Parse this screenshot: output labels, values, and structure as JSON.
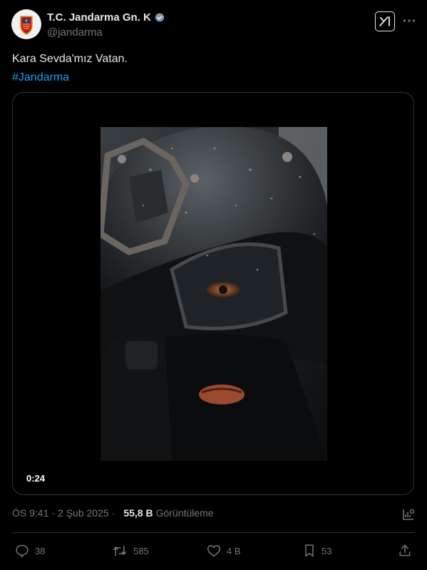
{
  "author": {
    "display_name": "T.C. Jandarma Gn. K",
    "handle": "@jandarma",
    "verified": true,
    "avatar_icon": "jandarma-emblem-icon"
  },
  "tweet": {
    "text": "Kara Sevda'mız Vatan.",
    "hashtag": "#Jandarma"
  },
  "media": {
    "type": "video",
    "duration": "0:24"
  },
  "meta": {
    "time": "ÖS 9:41",
    "separator": "·",
    "date": "2 Şub 2025",
    "views_count": "55,8 B",
    "views_label": "Görüntüleme"
  },
  "actions": {
    "replies": "38",
    "reposts": "585",
    "likes": "4 B",
    "bookmarks": "53"
  },
  "colors": {
    "background": "#000000",
    "text": "#e7e9ea",
    "muted": "#71767b",
    "accent": "#1d9bf0",
    "border": "#2f3336"
  }
}
